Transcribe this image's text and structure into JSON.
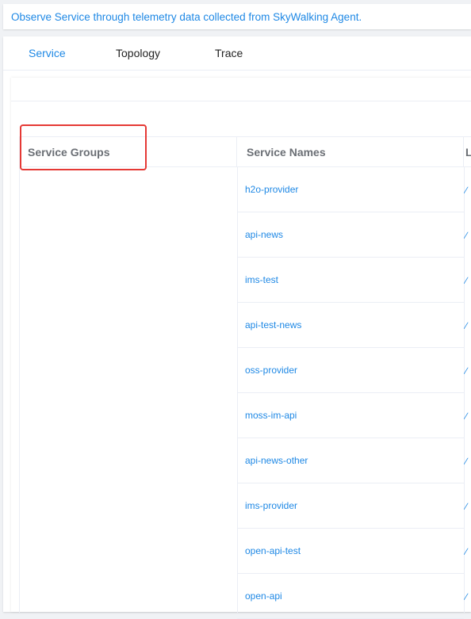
{
  "banner": {
    "text": "Observe Service through telemetry data collected from SkyWalking Agent."
  },
  "tabs": [
    {
      "label": "Service",
      "active": true
    },
    {
      "label": "Topology",
      "active": false
    },
    {
      "label": "Trace",
      "active": false
    }
  ],
  "table": {
    "columns": {
      "groups": "Service Groups",
      "names": "Service Names",
      "extra": "L"
    },
    "services": [
      {
        "name": "h2o-provider"
      },
      {
        "name": "api-news"
      },
      {
        "name": "ims-test"
      },
      {
        "name": "api-test-news"
      },
      {
        "name": "oss-provider"
      },
      {
        "name": "moss-im-api"
      },
      {
        "name": "api-news-other"
      },
      {
        "name": "ims-provider"
      },
      {
        "name": "open-api-test"
      },
      {
        "name": "open-api"
      }
    ]
  },
  "icons": {
    "row_action": "edit-icon"
  },
  "colors": {
    "accent": "#1e88e5",
    "highlight": "#e53935",
    "header_text": "#6b6f75"
  }
}
